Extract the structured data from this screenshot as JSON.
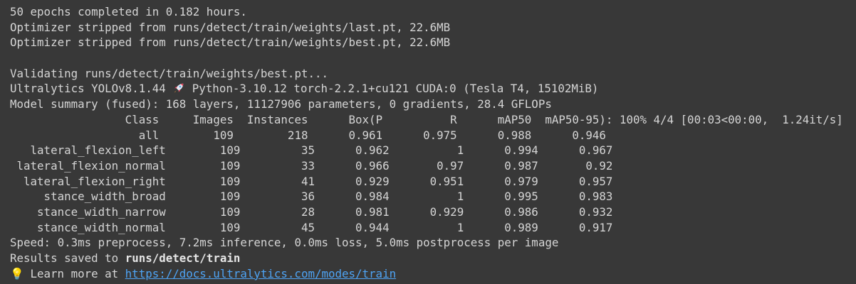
{
  "colors": {
    "background": "#383838",
    "text": "#d5d5d5",
    "link": "#4ea4f5"
  },
  "log": {
    "epochs_done": "50 epochs completed in 0.182 hours.",
    "strip_last": "Optimizer stripped from runs/detect/train/weights/last.pt, 22.6MB",
    "strip_best": "Optimizer stripped from runs/detect/train/weights/best.pt, 22.6MB",
    "validating": "Validating runs/detect/train/weights/best.pt...",
    "ultra_prefix": "Ultralytics YOLOv8.1.44 ",
    "ultra_icon": "rocket-icon",
    "ultra_suffix": " Python-3.10.12 torch-2.2.1+cu121 CUDA:0 (Tesla T4, 15102MiB)",
    "model_summary": "Model summary (fused): 168 layers, 11127906 parameters, 0 gradients, 28.4 GFLOPs",
    "table_header": "                 Class     Images  Instances      Box(P          R      mAP50  mAP50-95): 100% 4/4 [00:03<00:00,  1.24it/s]",
    "rows": [
      "                   all        109        218      0.961      0.975      0.988      0.946",
      "   lateral_flexion_left        109         35      0.962          1      0.994      0.967",
      " lateral_flexion_normal        109         33      0.966       0.97      0.987       0.92",
      "  lateral_flexion_right        109         41      0.929      0.951      0.979      0.957",
      "     stance_width_broad        109         36      0.984          1      0.995      0.983",
      "    stance_width_narrow        109         28      0.981      0.929      0.986      0.932",
      "    stance_width_normal        109         45      0.944          1      0.989      0.917"
    ],
    "speed": "Speed: 0.3ms preprocess, 7.2ms inference, 0.0ms loss, 5.0ms postprocess per image",
    "results_prefix": "Results saved to ",
    "results_path": "runs/detect/train",
    "learn_icon": "💡",
    "learn_prefix": " Learn more at ",
    "learn_link": "https://docs.ultralytics.com/modes/train"
  }
}
